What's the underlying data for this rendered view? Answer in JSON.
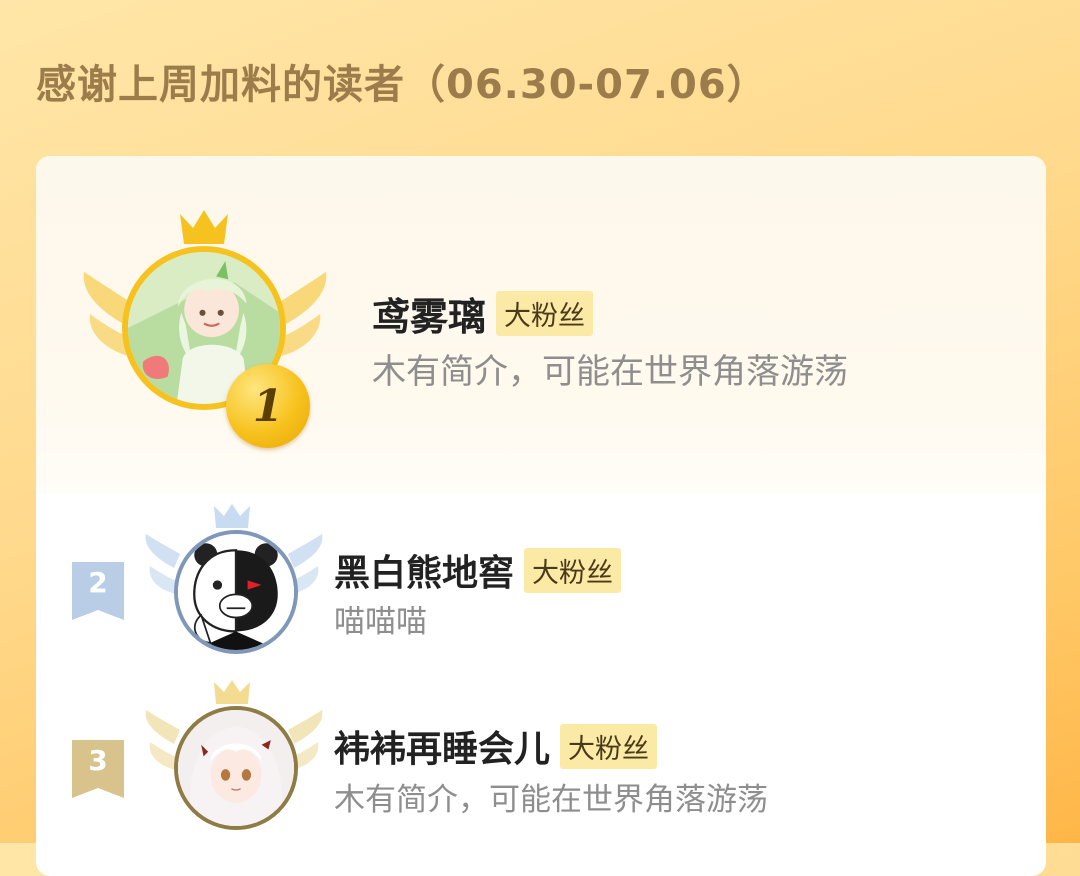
{
  "page_title": "感谢上周加料的读者（06.30-07.06）",
  "colors": {
    "gold": "#f6c21f",
    "silver_blue": "#b9cde6",
    "bronze": "#d9c38c",
    "fan_badge_bg": "#fbeaa6",
    "bio_gray": "#8e8e8e"
  },
  "leaderboard": [
    {
      "rank": "1",
      "name": "鸢雾璃",
      "badge": "大粉丝",
      "bio": "木有简介，可能在世界角落游荡",
      "avatar_icon": "anime-girl-green-hair-avatar"
    },
    {
      "rank": "2",
      "name": "黑白熊地窖",
      "badge": "大粉丝",
      "bio": "喵喵喵",
      "avatar_icon": "black-white-bear-avatar"
    },
    {
      "rank": "3",
      "name": "袆袆再睡会儿",
      "badge": "大粉丝",
      "bio": "木有简介，可能在世界角落游荡",
      "avatar_icon": "anime-girl-white-hair-avatar"
    }
  ]
}
